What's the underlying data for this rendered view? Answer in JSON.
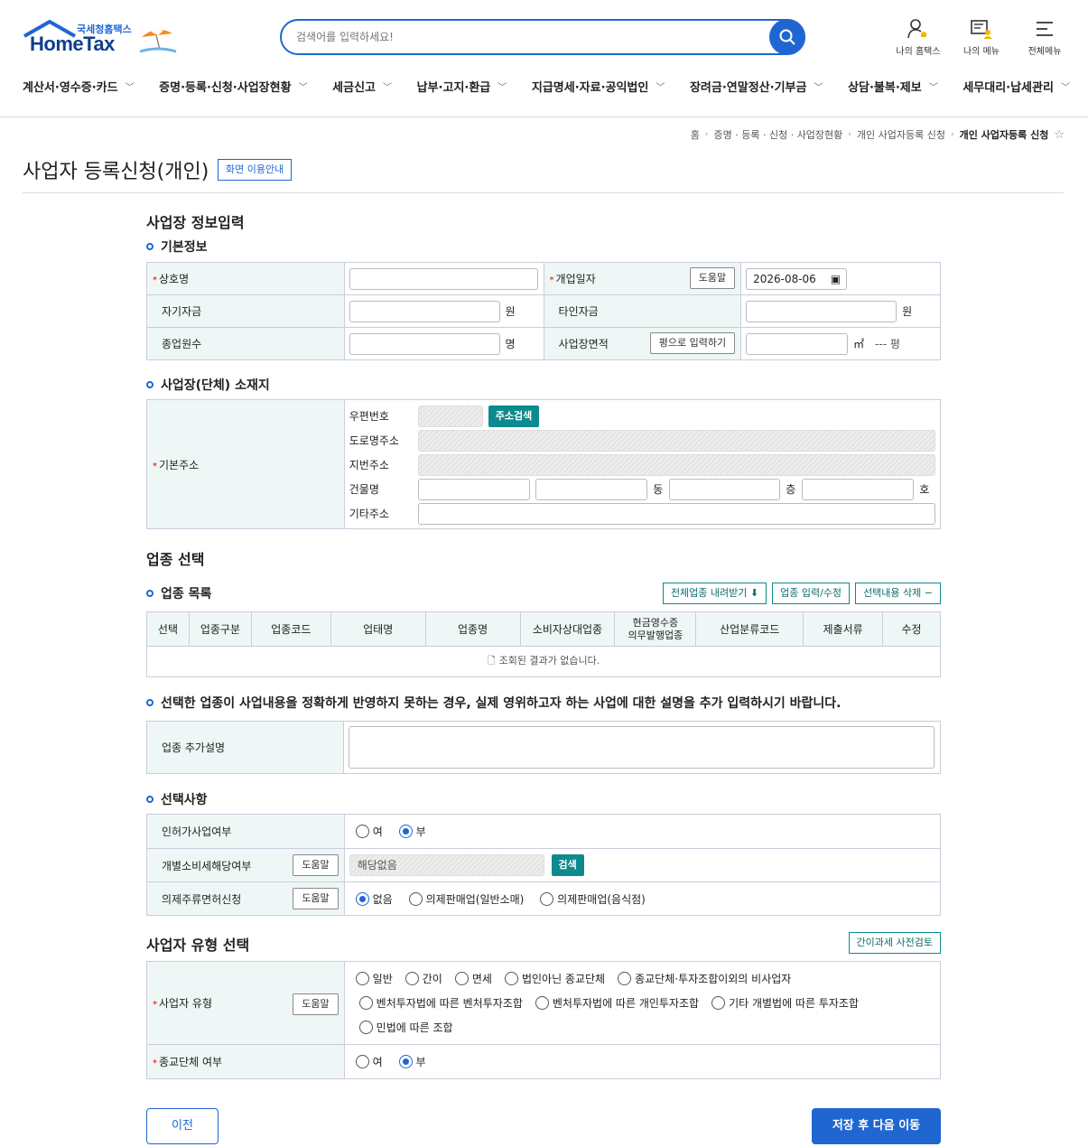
{
  "header": {
    "logo_small": "국세청홈택스",
    "logo_big": "HomeTax",
    "search_placeholder": "검색어를 입력하세요!",
    "icons": [
      {
        "label": "나의 홈택스"
      },
      {
        "label": "나의 메뉴"
      },
      {
        "label": "전체메뉴"
      }
    ],
    "nav": [
      "계산서·영수증·카드",
      "증명·등록·신청·사업장현황",
      "세금신고",
      "납부·고지·환급",
      "지급명세·자료·공익법인",
      "장려금·연말정산·기부금",
      "상담·불복·제보",
      "세무대리·납세관리"
    ]
  },
  "breadcrumb": [
    "홈",
    "증명 · 등록 · 신청 · 사업장현황",
    "개인 사업자등록 신청",
    "개인 사업자등록 신청"
  ],
  "page": {
    "title": "사업자 등록신청(개인)",
    "guide_button": "화면 이용안내"
  },
  "section1": {
    "title": "사업장 정보입력",
    "basic_title": "기본정보",
    "trade_name_label": "상호명",
    "open_date_label": "개업일자",
    "help_label": "도움말",
    "open_date_value": "2026-08-06",
    "own_capital_label": "자기자금",
    "other_capital_label": "타인자금",
    "won": "원",
    "employees_label": "종업원수",
    "persons": "명",
    "area_label": "사업장면적",
    "pyeong_button": "평으로 입력하기",
    "sqm": "㎡",
    "pyeong_value": "--- 평"
  },
  "address": {
    "title": "사업장(단체) 소재지",
    "basic_label": "기본주소",
    "zip_label": "우편번호",
    "search_button": "주소검색",
    "road_label": "도로명주소",
    "lot_label": "지번주소",
    "building_label": "건물명",
    "dong": "동",
    "floor": "층",
    "ho": "호",
    "other_label": "기타주소"
  },
  "industry": {
    "title": "업종 선택",
    "list_title": "업종 목록",
    "download_button": "전체업종 내려받기",
    "edit_button": "업종 입력/수정",
    "delete_button": "선택내용 삭제",
    "columns": [
      "선택",
      "업종구분",
      "업종코드",
      "업태명",
      "업종명",
      "소비자상대업종",
      "현금영수증\n의무발행업종",
      "산업분류코드",
      "제출서류",
      "수정"
    ],
    "empty_message": "조회된 결과가 없습니다.",
    "notice": "선택한 업종이 사업내용을 정확하게 반영하지 못하는 경우, 실제 영위하고자 하는 사업에 대한 설명을 추가 입력하시기 바랍니다.",
    "extra_label": "업종 추가설명"
  },
  "options": {
    "title": "선택사항",
    "license_label": "인허가사업여부",
    "yes": "여",
    "no": "부",
    "excise_label": "개별소비세해당여부",
    "help_label": "도움말",
    "excise_value": "해당없음",
    "search_button": "검색",
    "liquor_label": "의제주류면허신청",
    "liquor_options": [
      "없음",
      "의제판매업(일반소매)",
      "의제판매업(음식점)"
    ]
  },
  "biz_type": {
    "title": "사업자 유형 선택",
    "pre_check_button": "간이과세 사전검토",
    "type_label": "사업자 유형",
    "help_label": "도움말",
    "type_options_row1": [
      "일반",
      "간이",
      "면세",
      "법인아닌 종교단체",
      "종교단체·투자조합이외의 비사업자"
    ],
    "type_options_row2": [
      "벤처투자법에 따른 벤처투자조합",
      "벤처투자법에 따른 개인투자조합",
      "기타 개별법에 따른 투자조합"
    ],
    "type_options_row3": [
      "민법에 따른 조합"
    ],
    "religious_label": "종교단체 여부",
    "yes": "여",
    "no": "부"
  },
  "footer": {
    "prev_button": "이전",
    "next_button": "저장 후 다음 이동"
  },
  "colors": {
    "primary": "#1f66d1",
    "teal": "#0d8a8e",
    "header_bg": "#eef7f6"
  }
}
